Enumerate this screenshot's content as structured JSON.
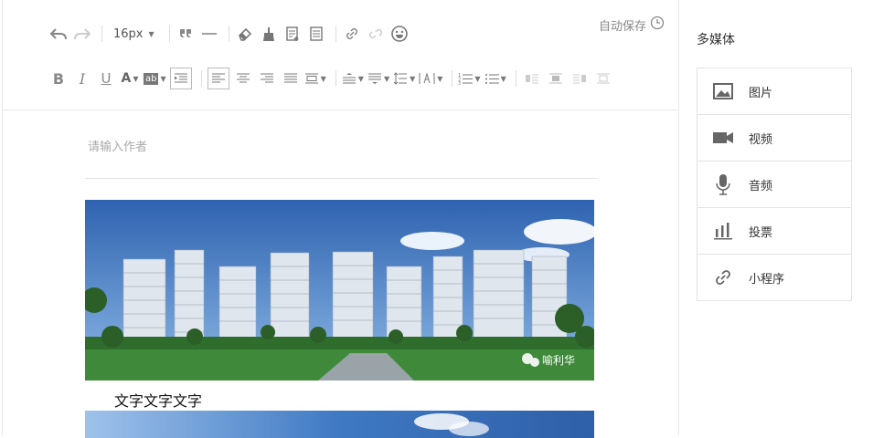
{
  "toolbar": {
    "font_size": "16px",
    "autosave_label": "自动保存"
  },
  "editor": {
    "author_placeholder": "请输入作者",
    "caption": "文字文字文字",
    "watermark": "喻利华"
  },
  "sidebar": {
    "title": "多媒体",
    "items": [
      {
        "label": "图片",
        "icon": "image-icon"
      },
      {
        "label": "视频",
        "icon": "video-icon"
      },
      {
        "label": "音频",
        "icon": "microphone-icon"
      },
      {
        "label": "投票",
        "icon": "bar-chart-icon"
      },
      {
        "label": "小程序",
        "icon": "link-icon"
      }
    ]
  },
  "colors": {
    "icon_gray": "#888888",
    "border": "#e3e3e3",
    "sky": "#3f79c3",
    "grass": "#3e8a3a"
  }
}
